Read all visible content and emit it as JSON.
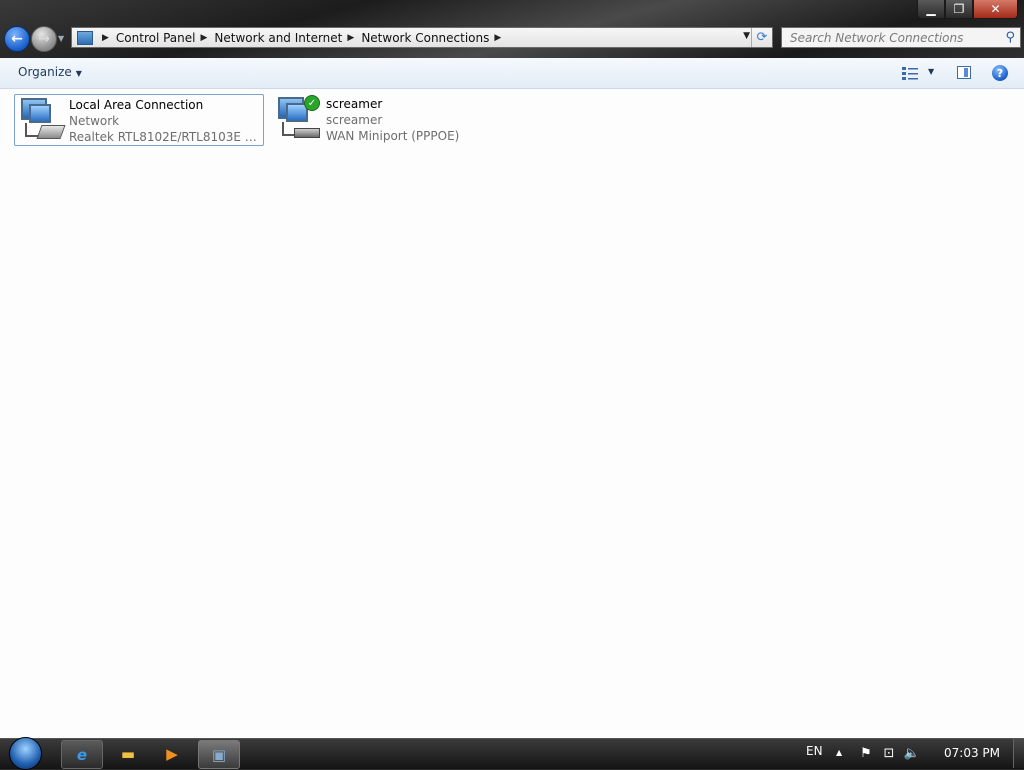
{
  "window_controls": {
    "minimize": "▁",
    "maximize": "❐",
    "close": "✕"
  },
  "nav": {
    "back_glyph": "←",
    "forward_glyph": "→"
  },
  "address": {
    "crumbs": [
      "Control Panel",
      "Network and Internet",
      "Network Connections"
    ],
    "separator": "▶"
  },
  "search": {
    "placeholder": "Search Network Connections"
  },
  "command_bar": {
    "organize_label": "Organize"
  },
  "connections": [
    {
      "name": "Local Area Connection",
      "status": "Network",
      "device": "Realtek RTL8102E/RTL8103E Famil...",
      "icon": "lan-adapter-icon",
      "selected": true
    },
    {
      "name": "screamer",
      "status": "screamer",
      "device": "WAN Miniport (PPPOE)",
      "icon": "broadband-connected-icon",
      "selected": false
    }
  ],
  "taskbar": {
    "language": "EN",
    "clock": "07:03 PM",
    "pinned": [
      "internet-explorer-icon",
      "windows-explorer-icon",
      "media-player-icon",
      "network-connections-icon"
    ]
  },
  "colors": {
    "selection_border": "#7da2ce",
    "content_bg": "#fdfdfd",
    "commandbar_text": "#1e395b"
  }
}
